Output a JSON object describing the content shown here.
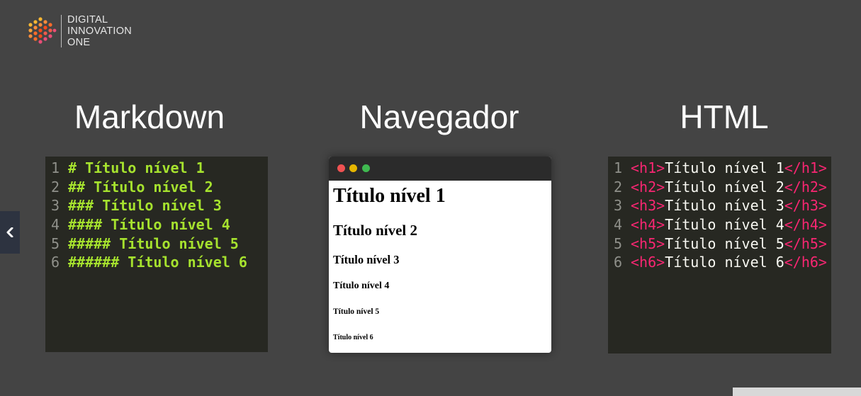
{
  "logo": {
    "icon": "dio-hexagon-logo-icon",
    "line1": "DIGITAL",
    "line2": "INNOVATION",
    "line3": "ONE",
    "colors": [
      "#f7b733",
      "#fc4a1a",
      "#e94e77"
    ]
  },
  "columns": {
    "markdown_title": "Markdown",
    "navegador_title": "Navegador",
    "html_title": "HTML"
  },
  "markdown": {
    "lines": [
      {
        "num": "1",
        "text": "# Título nível 1"
      },
      {
        "num": "2",
        "text": "## Título nível 2"
      },
      {
        "num": "3",
        "text": "### Título nível 3"
      },
      {
        "num": "4",
        "text": "#### Título nível 4"
      },
      {
        "num": "5",
        "text": "##### Título nível 5"
      },
      {
        "num": "6",
        "text": "###### Título nível 6"
      }
    ]
  },
  "browser": {
    "headings": [
      "Título nível 1",
      "Título nível 2",
      "Título nível 3",
      "Título nível 4",
      "Título nível 5",
      "Título nível 6"
    ]
  },
  "html": {
    "lines": [
      {
        "num": "1",
        "open": "<h1>",
        "text": "Título nível 1",
        "close": "</h1>"
      },
      {
        "num": "2",
        "open": "<h2>",
        "text": "Título nível 2",
        "close": "</h2>"
      },
      {
        "num": "3",
        "open": "<h3>",
        "text": "Título nível 3",
        "close": "</h3>"
      },
      {
        "num": "4",
        "open": "<h4>",
        "text": "Título nível 4",
        "close": "</h4>"
      },
      {
        "num": "5",
        "open": "<h5>",
        "text": "Título nível 5",
        "close": "</h5>"
      },
      {
        "num": "6",
        "open": "<h6>",
        "text": "Título nível 6",
        "close": "</h6>"
      }
    ]
  },
  "colors": {
    "background": "#444444",
    "editor_bg": "#272822",
    "markdown_text": "#a6e22e",
    "html_tag": "#f92672",
    "line_number": "#8f908a"
  },
  "nav": {
    "prev_icon": "chevron-left-icon"
  }
}
